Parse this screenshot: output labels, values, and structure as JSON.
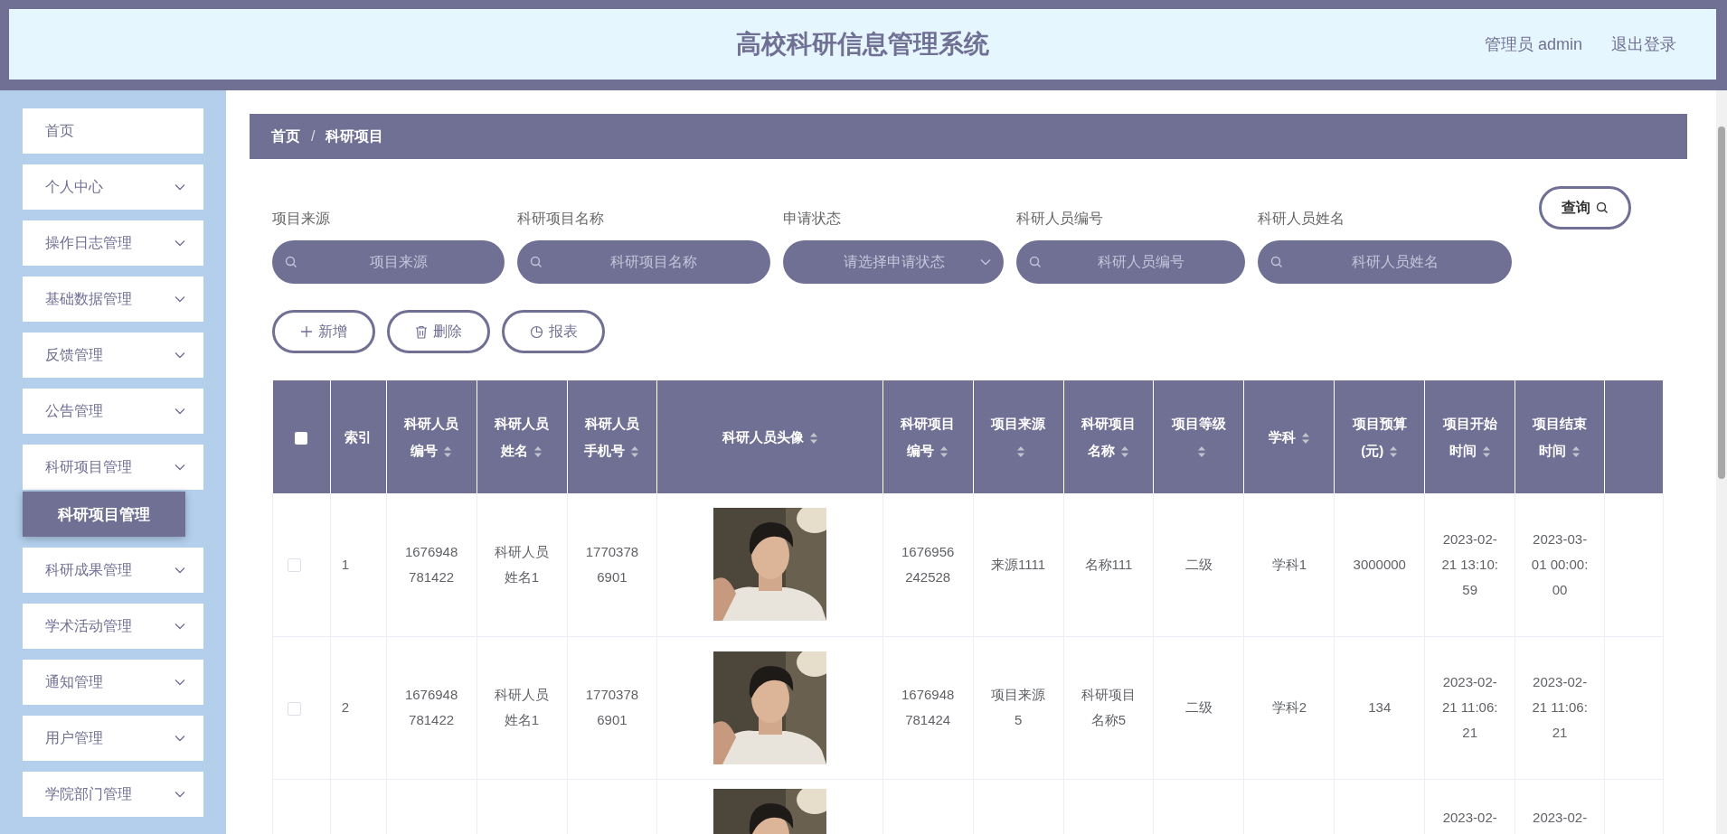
{
  "header": {
    "title": "高校科研信息管理系统",
    "user": "管理员 admin",
    "logout": "退出登录"
  },
  "sidebar": {
    "items": [
      {
        "label": "首页",
        "kind": "link"
      },
      {
        "label": "个人中心",
        "kind": "menu"
      },
      {
        "label": "操作日志管理",
        "kind": "menu"
      },
      {
        "label": "基础数据管理",
        "kind": "menu"
      },
      {
        "label": "反馈管理",
        "kind": "menu"
      },
      {
        "label": "公告管理",
        "kind": "menu"
      },
      {
        "label": "科研项目管理",
        "kind": "menu",
        "expanded": true,
        "children": [
          {
            "label": "科研项目管理",
            "selected": true
          }
        ]
      },
      {
        "label": "科研成果管理",
        "kind": "menu"
      },
      {
        "label": "学术活动管理",
        "kind": "menu"
      },
      {
        "label": "通知管理",
        "kind": "menu"
      },
      {
        "label": "用户管理",
        "kind": "menu"
      },
      {
        "label": "学院部门管理",
        "kind": "menu"
      }
    ]
  },
  "breadcrumb": {
    "items": [
      "首页",
      "科研项目"
    ],
    "separator": "/"
  },
  "filters": [
    {
      "label": "项目来源",
      "placeholder": "项目来源",
      "kind": "search"
    },
    {
      "label": "科研项目名称",
      "placeholder": "科研项目名称",
      "kind": "search"
    },
    {
      "label": "申请状态",
      "placeholder": "请选择申请状态",
      "kind": "select"
    },
    {
      "label": "科研人员编号",
      "placeholder": "科研人员编号",
      "kind": "search"
    },
    {
      "label": "科研人员姓名",
      "placeholder": "科研人员姓名",
      "kind": "search"
    }
  ],
  "query_button": "查询",
  "actions": [
    {
      "label": "新增",
      "kind": "add"
    },
    {
      "label": "删除",
      "kind": "delete"
    },
    {
      "label": "报表",
      "kind": "report"
    }
  ],
  "table": {
    "header_checked": false,
    "columns": [
      {
        "kind": "checkbox"
      },
      {
        "kind": "text",
        "label": "索引"
      },
      {
        "kind": "text",
        "label": "科研人员编号",
        "sortable": true
      },
      {
        "kind": "text",
        "label": "科研人员姓名",
        "sortable": true
      },
      {
        "kind": "text",
        "label": "科研人员手机号",
        "sortable": true
      },
      {
        "kind": "picture",
        "label": "科研人员头像",
        "sortable": true
      },
      {
        "kind": "text",
        "label": "科研项目编号",
        "sortable": true
      },
      {
        "kind": "text",
        "label": "项目来源",
        "sortable": true
      },
      {
        "kind": "text",
        "label": "科研项目名称",
        "sortable": true
      },
      {
        "kind": "text",
        "label": "项目等级",
        "sortable": true
      },
      {
        "kind": "text",
        "label": "学科",
        "sortable": true
      },
      {
        "kind": "text",
        "label": "项目预算(元)",
        "sortable": true
      },
      {
        "kind": "text",
        "label": "项目开始时间",
        "sortable": true
      },
      {
        "kind": "text",
        "label": "项目结束时间",
        "sortable": true
      },
      {
        "kind": "blank"
      }
    ],
    "rows": [
      {
        "checked": false,
        "cells": [
          "",
          "1",
          "1676948781422",
          "科研人员姓名1",
          "17703786901",
          "",
          "1676956242528",
          "来源1111",
          "名称111",
          "二级",
          "学科1",
          "3000000",
          "2023-02-21 13:10:59",
          "2023-03-01 00:00:00",
          ""
        ]
      },
      {
        "checked": false,
        "cells": [
          "",
          "2",
          "1676948781422",
          "科研人员姓名1",
          "17703786901",
          "",
          "1676948781424",
          "项目来源5",
          "科研项目名称5",
          "二级",
          "学科2",
          "134",
          "2023-02-21 11:06:21",
          "2023-02-21 11:06:21",
          ""
        ]
      },
      {
        "cut": true,
        "cells": [
          "",
          "",
          "",
          "",
          "",
          "",
          "",
          "",
          "",
          "",
          "",
          "",
          "2023-02-",
          "2023-02-",
          ""
        ]
      }
    ]
  }
}
